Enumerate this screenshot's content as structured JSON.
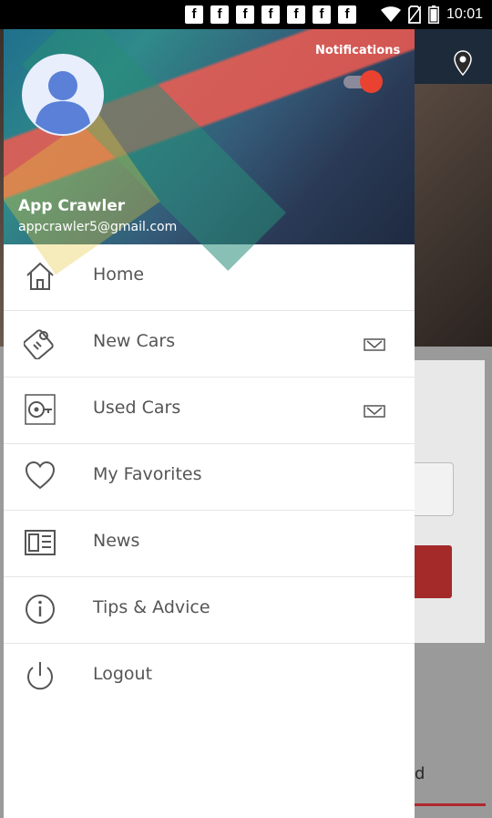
{
  "status_bar": {
    "notification_icons": [
      "f",
      "f",
      "f",
      "f",
      "f",
      "f",
      "f"
    ],
    "time": "10:01"
  },
  "drawer": {
    "header": {
      "user_name": "App Crawler",
      "email": "appcrawler5@gmail.com",
      "notifications_label": "Notifications",
      "notifications_switch_on": true
    },
    "menu": [
      {
        "label": "Home",
        "icon": "home-icon",
        "expandable": false
      },
      {
        "label": "New Cars",
        "icon": "car-key-icon",
        "expandable": true
      },
      {
        "label": "Used Cars",
        "icon": "used-car-key-icon",
        "expandable": true
      },
      {
        "label": "My Favorites",
        "icon": "heart-icon",
        "expandable": false
      },
      {
        "label": "News",
        "icon": "news-icon",
        "expandable": false
      },
      {
        "label": "Tips & Advice",
        "icon": "info-icon",
        "expandable": false
      },
      {
        "label": "Logout",
        "icon": "power-icon",
        "expandable": false
      }
    ]
  },
  "background_page": {
    "partial_text": "d"
  },
  "colors": {
    "switch_thumb": "#e94230",
    "accent_red": "#b0282e",
    "menu_text": "#555555",
    "icon_stroke": "#555555"
  }
}
